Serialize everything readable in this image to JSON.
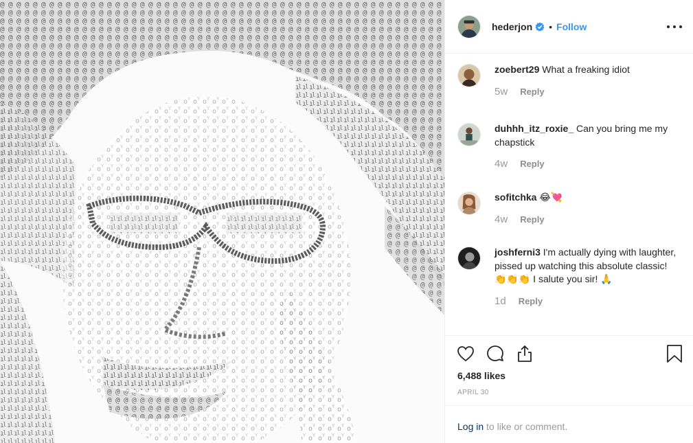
{
  "post": {
    "author": {
      "username": "hederjon",
      "verified": true,
      "follow_label": "Follow",
      "separator": "•"
    },
    "media": {
      "description_icon": "portrait-image",
      "accent": "#555555"
    },
    "comments": [
      {
        "user": "zoebert29",
        "text": "What a freaking idiot",
        "time": "5w",
        "reply_label": "Reply"
      },
      {
        "user": "duhhh_itz_roxie_",
        "text": "Can you bring me my chapstick",
        "time": "4w",
        "reply_label": "Reply"
      },
      {
        "user": "sofitchka",
        "text": "😂💘",
        "time": "4w",
        "reply_label": "Reply"
      },
      {
        "user": "joshferni3",
        "text": "I'm actually dying with laughter, pissed up watching this absolute classic! 👏👏👏 I salute you sir! 🙏",
        "time": "1d",
        "reply_label": "Reply"
      }
    ],
    "likes": "6,488 likes",
    "date": "April 30",
    "login": {
      "link_label": "Log in",
      "suffix": " to like or comment."
    }
  },
  "colors": {
    "link_blue": "#3897f0",
    "verified_blue": "#3897f0",
    "muted": "#999999",
    "border": "#efefef"
  },
  "icons": [
    "more-options-icon",
    "heart-icon",
    "comment-icon",
    "share-icon",
    "bookmark-icon",
    "verified-badge-icon"
  ]
}
